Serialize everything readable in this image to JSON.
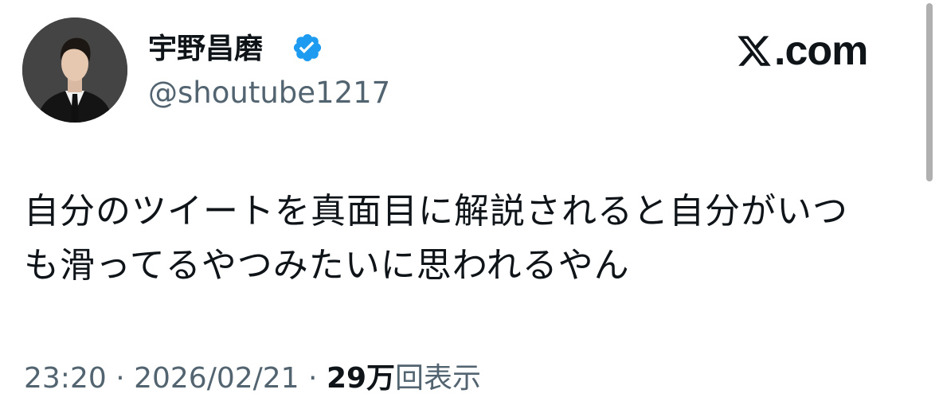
{
  "author": {
    "display_name": "宇野昌磨",
    "handle": "@shoutube1217",
    "verified": true,
    "avatar_icon": "profile-photo"
  },
  "logo": {
    "text": ".com",
    "icon": "x-logo-icon"
  },
  "tweet": {
    "lines": [
      "自分のツイートを真面目に解説されると自分がいつ",
      "も滑ってるやつみたいに思われるやん"
    ]
  },
  "meta": {
    "time": "23:20",
    "separator": "·",
    "date": "2026/02/21",
    "views_count": "29万",
    "views_label": "回表示"
  },
  "colors": {
    "text_primary": "#0f1419",
    "text_secondary": "#536471",
    "verified_badge": "#1d9bf0"
  }
}
